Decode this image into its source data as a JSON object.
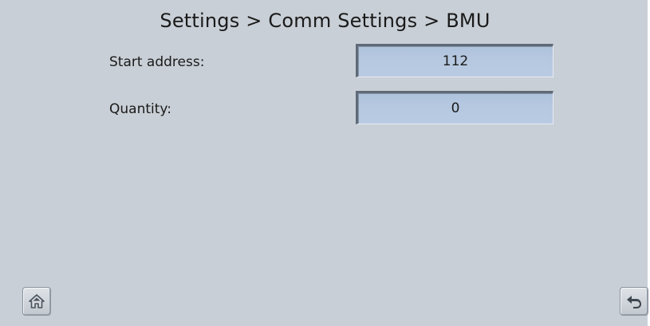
{
  "header": {
    "title": "Settings > Comm Settings > BMU"
  },
  "fields": [
    {
      "label": "Start address:",
      "value": "112"
    },
    {
      "label": "Quantity:",
      "value": "0"
    }
  ],
  "footer": {
    "home_icon": "home-icon",
    "back_icon": "back-arrow-icon"
  },
  "colors": {
    "background": "#c9cfd6",
    "field_fill": "#b6c8e0",
    "text": "#1a1a1a"
  }
}
